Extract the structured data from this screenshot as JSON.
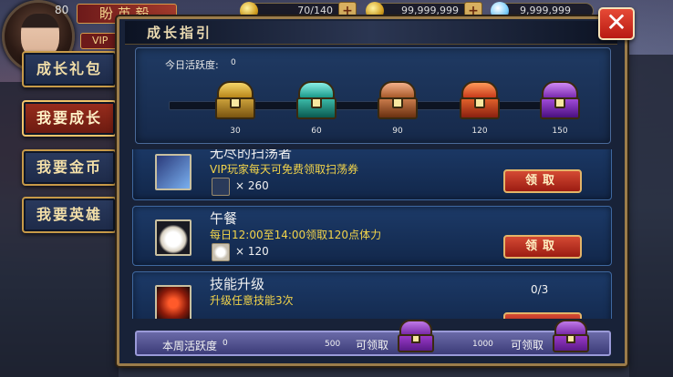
{
  "hud": {
    "level": "80",
    "player_name": "盼 英 毅",
    "vip": "VIP",
    "stamina": "70/140",
    "gold": "99,999,999",
    "diamonds": "9,999,999",
    "plus": "+"
  },
  "side_menu": [
    {
      "label": "成长礼包",
      "active": false
    },
    {
      "label": "我要成长",
      "active": true
    },
    {
      "label": "我要金币",
      "active": false
    },
    {
      "label": "我要英雄",
      "active": false
    }
  ],
  "panel": {
    "title": "成长指引",
    "close_label": "✕"
  },
  "activity": {
    "label": "今日活跃度:",
    "value": "0",
    "progress": 0,
    "chests": [
      {
        "value": "30",
        "color": "gold"
      },
      {
        "value": "60",
        "color": "teal"
      },
      {
        "value": "90",
        "color": "bronze"
      },
      {
        "value": "120",
        "color": "red"
      },
      {
        "value": "150",
        "color": "purple"
      }
    ]
  },
  "tasks": [
    {
      "name": "无尽的扫荡者",
      "desc": "VIP玩家每天可免费领取扫荡券",
      "reward_qty": "× 260",
      "button": "领取",
      "icon": "sweep-ticket-icon"
    },
    {
      "name": "午餐",
      "desc": "每日12:00至14:00领取120点体力",
      "reward_qty": "× 120",
      "button": "领取",
      "icon": "bun-icon"
    },
    {
      "name": "技能升级",
      "desc": "升级任意技能3次",
      "progress": "0/3",
      "icon": "skill-up-icon"
    }
  ],
  "weekly": {
    "label": "本周活跃度",
    "value": "0",
    "milestone1": "500",
    "milestone2": "1000",
    "tag": "可领取"
  }
}
